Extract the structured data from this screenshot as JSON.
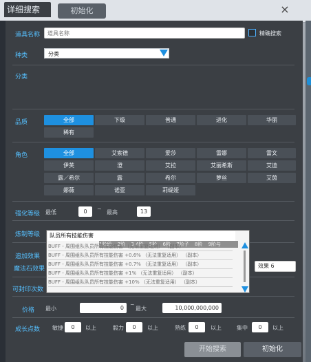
{
  "dialog": {
    "title": "详细搜索",
    "init_tab": "初始化",
    "close": "×"
  },
  "item_name": {
    "label": "道具名称",
    "placeholder": "道具名称",
    "exact_label": "精确搜索"
  },
  "category": {
    "label": "种类",
    "value": "分类"
  },
  "subcategory": {
    "label": "分类"
  },
  "grade": {
    "label": "品质",
    "options": [
      "全部",
      "下级",
      "普通",
      "进化",
      "华丽",
      "稀有"
    ],
    "selected": "全部"
  },
  "character": {
    "label": "角色",
    "options": [
      "全部",
      "艾索德",
      "爱莎",
      "雷娜",
      "雷文",
      "伊芙",
      "澄",
      "艾拉",
      "艾丽希斯",
      "艾迪",
      "露／希尔",
      "露",
      "希尔",
      "萝丝",
      "艾茵",
      "娜薇",
      "诺亚",
      "莉缇娅"
    ],
    "selected": "全部"
  },
  "enhance": {
    "label": "强化等级",
    "min_label": "最低",
    "min_value": "0",
    "tilde": "~",
    "max_label": "最高",
    "max_value": "13"
  },
  "refine": {
    "label": "炼制等级"
  },
  "extra_effect": {
    "label": "追加效果"
  },
  "magic_stone": {
    "label": "魔法石效果",
    "effect_value": "效果 6"
  },
  "seal": {
    "label": "可封印次数"
  },
  "price": {
    "label": "价格",
    "min_label": "最小",
    "min_value": "0",
    "tilde": "~",
    "max_label": "最大",
    "max_value": "10,000,000,000"
  },
  "growth": {
    "label": "成长点数",
    "fields": [
      {
        "name": "敏捷",
        "value": "0",
        "suffix": "以上"
      },
      {
        "name": "毅力",
        "value": "0",
        "suffix": "以上"
      },
      {
        "name": "熟练",
        "value": "0",
        "suffix": "以上"
      },
      {
        "name": "集中",
        "value": "0",
        "suffix": "以上"
      }
    ]
  },
  "popup": {
    "header": "队员所有技能伤害",
    "levels": [
      "1阶段",
      "2阶",
      "3 4阶",
      "5阶",
      "6阶",
      "7阶子",
      "8阶",
      "9阶与"
    ],
    "items": [
      "BUFF - 周围组队队员所有技能伤害 （无法重复适用） （副本）",
      "BUFF - 周围组队队员所有技能伤害 +0.6% （无法重复适用） （副本）",
      "BUFF - 周围组队队员所有技能伤害 +0.7% （无法重复适用） （副本）",
      "BUFF - 周围组队队员所有技能伤害 +1% （无法重复适用） （副本）",
      "BUFF - 周围组队队员所有技能伤害 +10% （无法重复适用） （副本）"
    ]
  },
  "footer": {
    "search_label": "开始搜索",
    "reset_label": "初始化"
  },
  "colors": {
    "accent": "#1e90e0",
    "label": "#56c0ff",
    "dialog_bg": "#3b3f44"
  }
}
